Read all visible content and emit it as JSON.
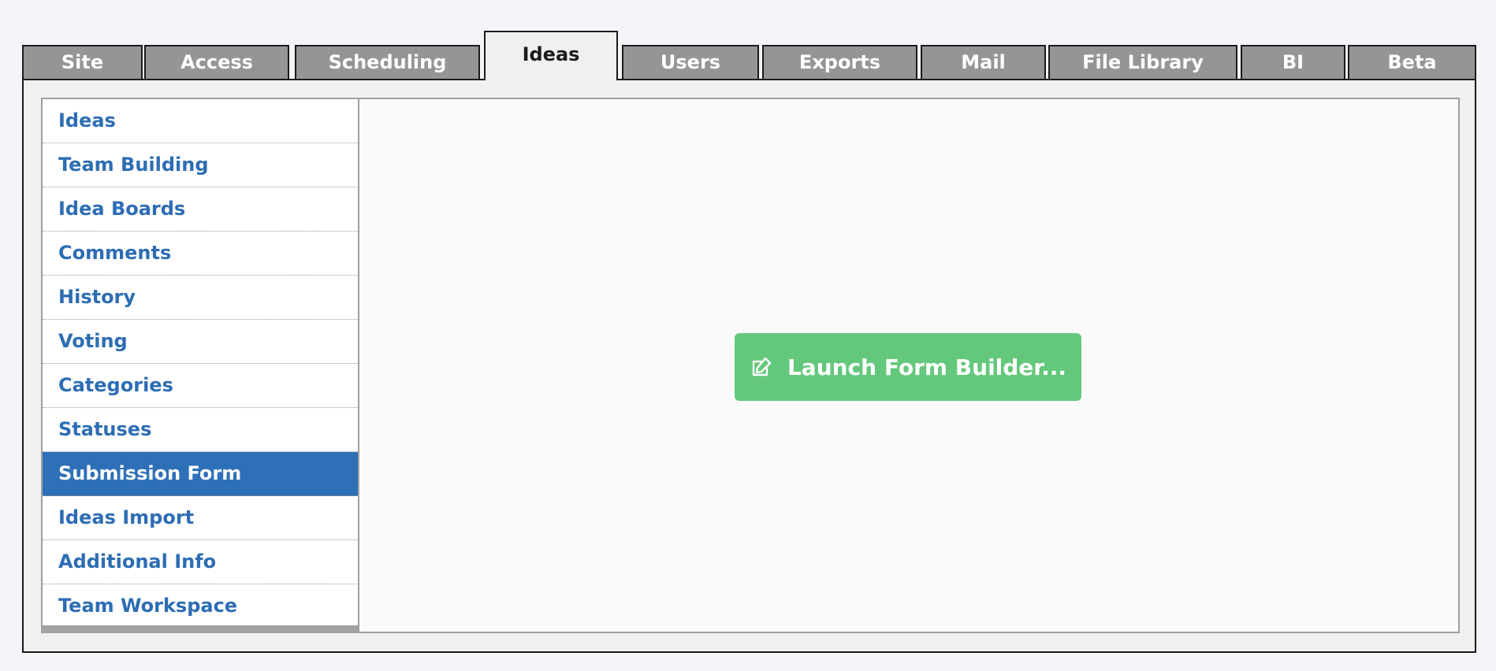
{
  "tabs": [
    {
      "label": "Site"
    },
    {
      "label": "Access"
    },
    {
      "label": "Scheduling"
    },
    {
      "label": "Ideas"
    },
    {
      "label": "Users"
    },
    {
      "label": "Exports"
    },
    {
      "label": "Mail"
    },
    {
      "label": "File Library"
    },
    {
      "label": "BI"
    },
    {
      "label": "Beta"
    }
  ],
  "active_tab": "Ideas",
  "sidebar": {
    "items": [
      {
        "label": "Ideas"
      },
      {
        "label": "Team Building"
      },
      {
        "label": "Idea Boards"
      },
      {
        "label": "Comments"
      },
      {
        "label": "History"
      },
      {
        "label": "Voting"
      },
      {
        "label": "Categories"
      },
      {
        "label": "Statuses"
      },
      {
        "label": "Submission Form"
      },
      {
        "label": "Ideas Import"
      },
      {
        "label": "Additional Info"
      },
      {
        "label": "Team Workspace"
      }
    ],
    "selected": "Submission Form"
  },
  "main": {
    "launch_button": {
      "label": "Launch Form Builder...",
      "icon": "edit-icon"
    }
  },
  "colors": {
    "accent": "#2e70b7",
    "link": "#2d6db4",
    "button_green": "#63c87b",
    "tab_inactive": "#959595"
  }
}
